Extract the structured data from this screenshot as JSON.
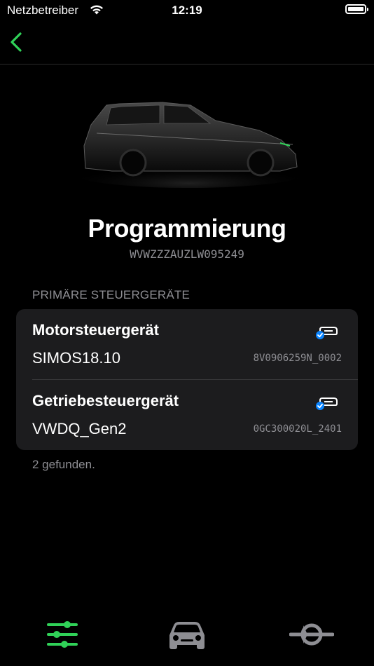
{
  "status_bar": {
    "carrier": "Netzbetreiber",
    "time": "12:19"
  },
  "header": {
    "title": "Programmierung",
    "vin": "WVWZZZAUZLW095249"
  },
  "section": {
    "header": "PRIMÄRE STEUERGERÄTE"
  },
  "ecus": [
    {
      "name": "Motorsteuergerät",
      "software": "SIMOS18.10",
      "part_number": "8V0906259N_0002"
    },
    {
      "name": "Getriebesteuergerät",
      "software": "VWDQ_Gen2",
      "part_number": "0GC300020L_2401"
    }
  ],
  "footer": {
    "found_text": "2 gefunden."
  },
  "tabs": [
    {
      "name": "sliders-icon",
      "active": true
    },
    {
      "name": "car-icon",
      "active": false
    },
    {
      "name": "connector-icon",
      "active": false
    }
  ],
  "colors": {
    "accent": "#30d158",
    "inactive": "#8e8e93",
    "badge": "#0a84ff",
    "card": "#1c1c1e"
  }
}
